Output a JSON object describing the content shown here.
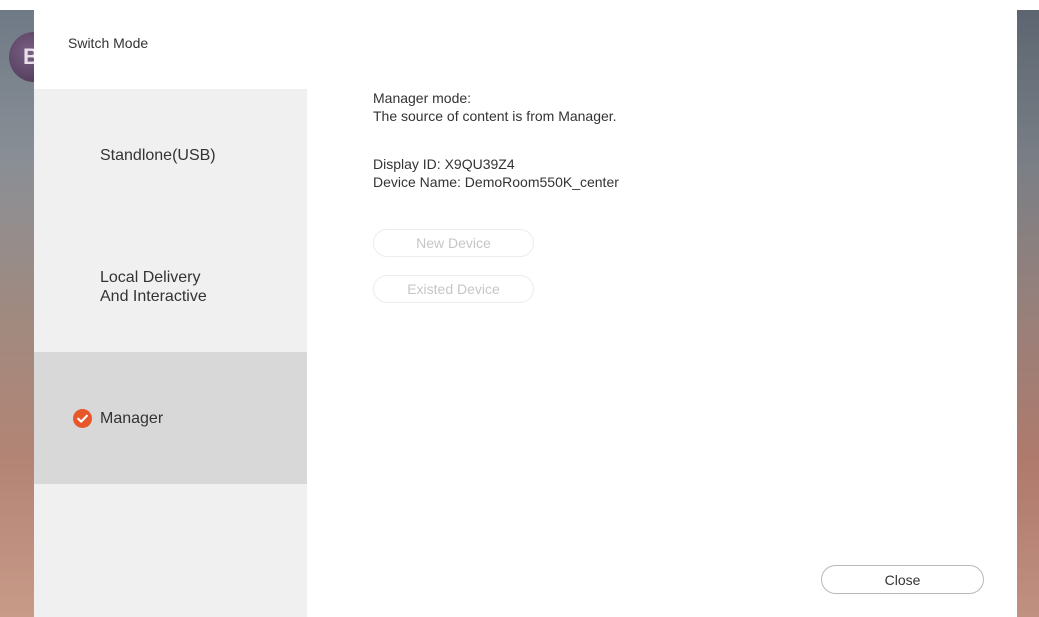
{
  "background": {
    "logo_letter": "B"
  },
  "dialog": {
    "title": "Switch Mode"
  },
  "sidebar": {
    "items": [
      {
        "label": "Standlone(USB)",
        "selected": false
      },
      {
        "label": "Local Delivery\nAnd Interactive",
        "selected": false
      },
      {
        "label": "Manager",
        "selected": true,
        "icon": "check-circle-icon"
      }
    ]
  },
  "content": {
    "mode_title": "Manager mode:",
    "mode_description": "The source of content is from Manager.",
    "display_id": "Display ID: X9QU39Z4",
    "device_name": "Device Name: DemoRoom550K_center",
    "new_device_label": "New Device",
    "existed_device_label": "Existed Device"
  },
  "footer": {
    "close_label": "Close"
  },
  "colors": {
    "accent": "#e8572a",
    "selected_bg": "#d8d8d8",
    "sidebar_bg": "#f0f0f0",
    "disabled_text": "#c6c6c6"
  }
}
